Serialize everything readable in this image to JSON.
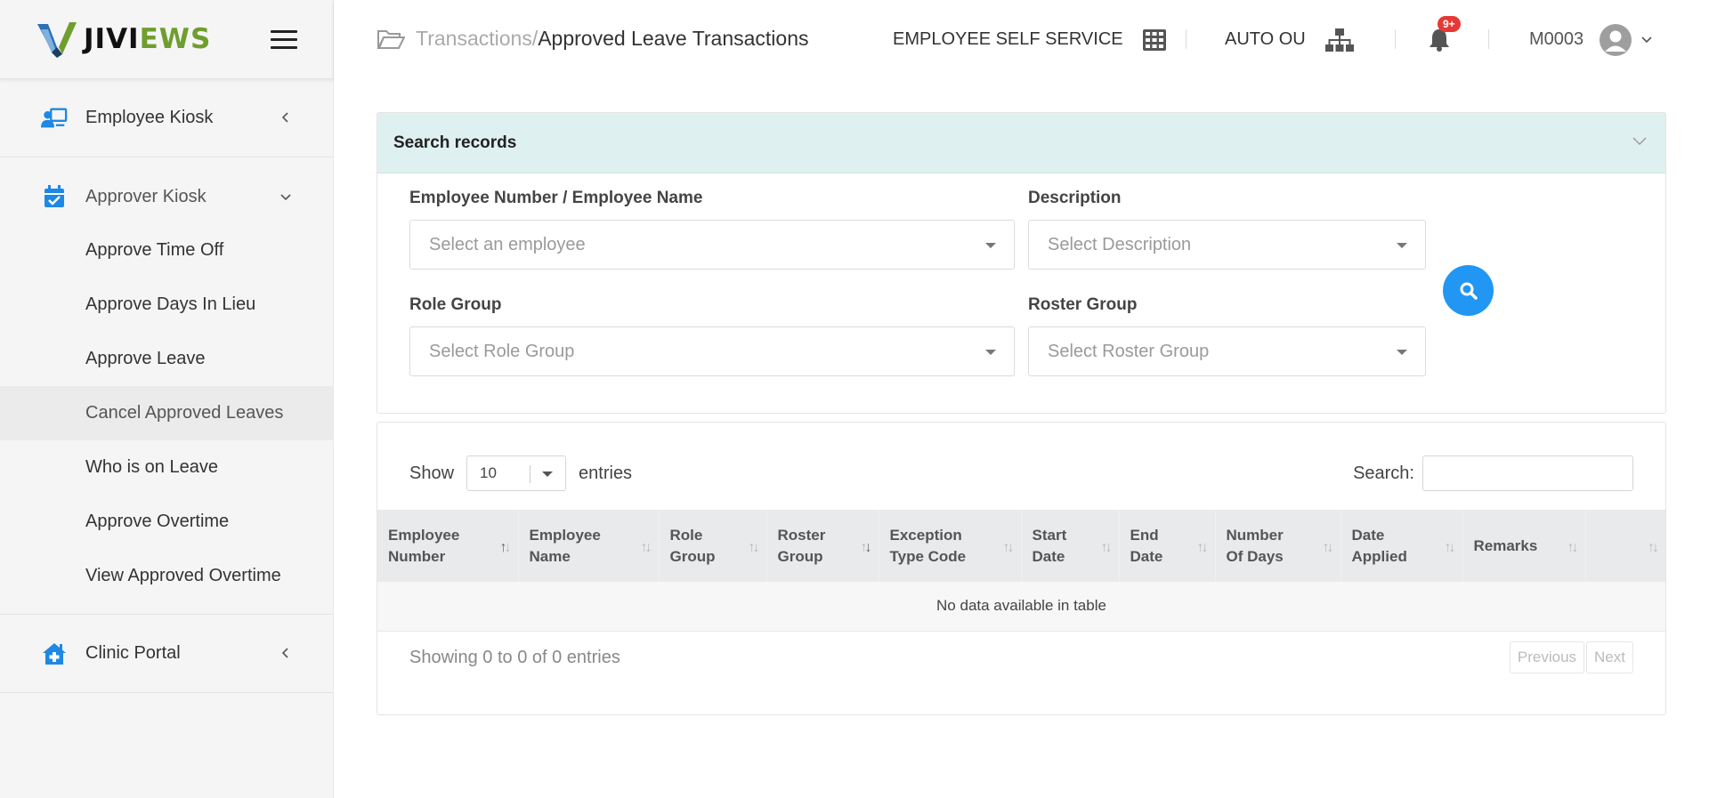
{
  "brand": {
    "name_part1": "JIVI",
    "name_part2": "EWS",
    "accent": "#6f9e2e"
  },
  "sidebar": {
    "groups": [
      {
        "label": "Employee Kiosk",
        "icon": "employee-kiosk-icon"
      },
      {
        "label": "Approver Kiosk",
        "icon": "calendar-check-icon"
      },
      {
        "label": "Clinic Portal",
        "icon": "clinic-house-icon"
      }
    ],
    "approver_items": [
      {
        "label": "Approve Time Off"
      },
      {
        "label": "Approve Days In Lieu"
      },
      {
        "label": "Approve Leave"
      },
      {
        "label": "Cancel Approved Leaves",
        "active": true
      },
      {
        "label": "Who is on Leave"
      },
      {
        "label": "Approve Overtime"
      },
      {
        "label": "View Approved Overtime"
      }
    ]
  },
  "header": {
    "breadcrumb_parent": "Transactions/",
    "breadcrumb_current": "Approved Leave Transactions",
    "ess_label": "EMPLOYEE SELF SERVICE",
    "ou_label": "AUTO OU",
    "notifications_badge": "9+",
    "user_code": "M0003"
  },
  "search": {
    "title": "Search records",
    "fields": {
      "employee_label": "Employee Number / Employee Name",
      "employee_placeholder": "Select an employee",
      "description_label": "Description",
      "description_placeholder": "Select Description",
      "role_label": "Role Group",
      "role_placeholder": "Select Role Group",
      "roster_label": "Roster Group",
      "roster_placeholder": "Select Roster Group"
    }
  },
  "table": {
    "show_label": "Show",
    "entries_value": "10",
    "entries_label": "entries",
    "search_label": "Search:",
    "columns": [
      {
        "line1": "Employee",
        "line2": "Number"
      },
      {
        "line1": "Employee",
        "line2": "Name"
      },
      {
        "line1": "Role",
        "line2": "Group"
      },
      {
        "line1": "Roster",
        "line2": "Group"
      },
      {
        "line1": "Exception",
        "line2": "Type Code"
      },
      {
        "line1": "Start",
        "line2": "Date"
      },
      {
        "line1": "End",
        "line2": "Date"
      },
      {
        "line1": "Number",
        "line2": "Of Days"
      },
      {
        "line1": "Date",
        "line2": "Applied"
      },
      {
        "line1": "Remarks",
        "line2": ""
      },
      {
        "line1": "",
        "line2": ""
      }
    ],
    "empty_message": "No data available in table",
    "info": "Showing 0 to 0 of 0 entries",
    "prev_label": "Previous",
    "next_label": "Next"
  },
  "colors": {
    "primary_blue": "#2196f3",
    "icon_blue": "#1e88e5",
    "badge_red": "#e53935",
    "search_header_bg": "#dff0f0"
  }
}
